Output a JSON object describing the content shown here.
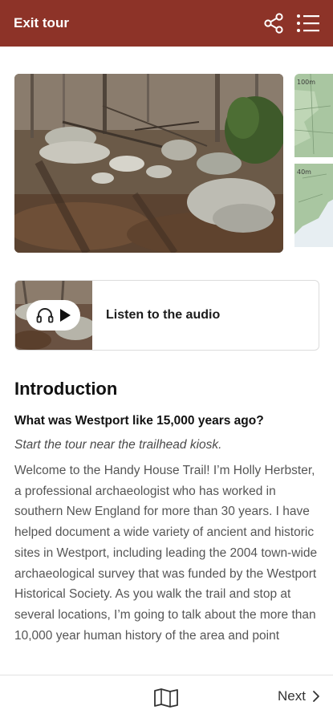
{
  "header": {
    "exit_label": "Exit tour",
    "background": "#8d3328"
  },
  "map_preview": {
    "label_top": "100m",
    "label_bottom": "40m"
  },
  "audio": {
    "label": "Listen to the audio"
  },
  "content": {
    "title": "Introduction",
    "question": "What was Westport like 15,000 years ago?",
    "direction": "Start the tour near the trailhead kiosk.",
    "body": "Welcome to the Handy House Trail! I’m Holly Herbster, a professional archaeologist who has worked in southern New England for more than 30 years. I have helped document a wide variety of ancient and historic sites in Westport, including leading the 2004 town-wide archaeological survey that was funded by the Westport Historical Society. As you walk the trail and stop at several locations, I’m going to talk about the more than 10,000 year human history of the area and point"
  },
  "footer": {
    "next_label": "Next"
  },
  "icons": {
    "share": "share-icon",
    "menu": "list-menu-icon",
    "map": "folded-map-icon",
    "headphones": "headphones-icon",
    "play": "play-icon",
    "chevron": "chevron-right-icon"
  }
}
